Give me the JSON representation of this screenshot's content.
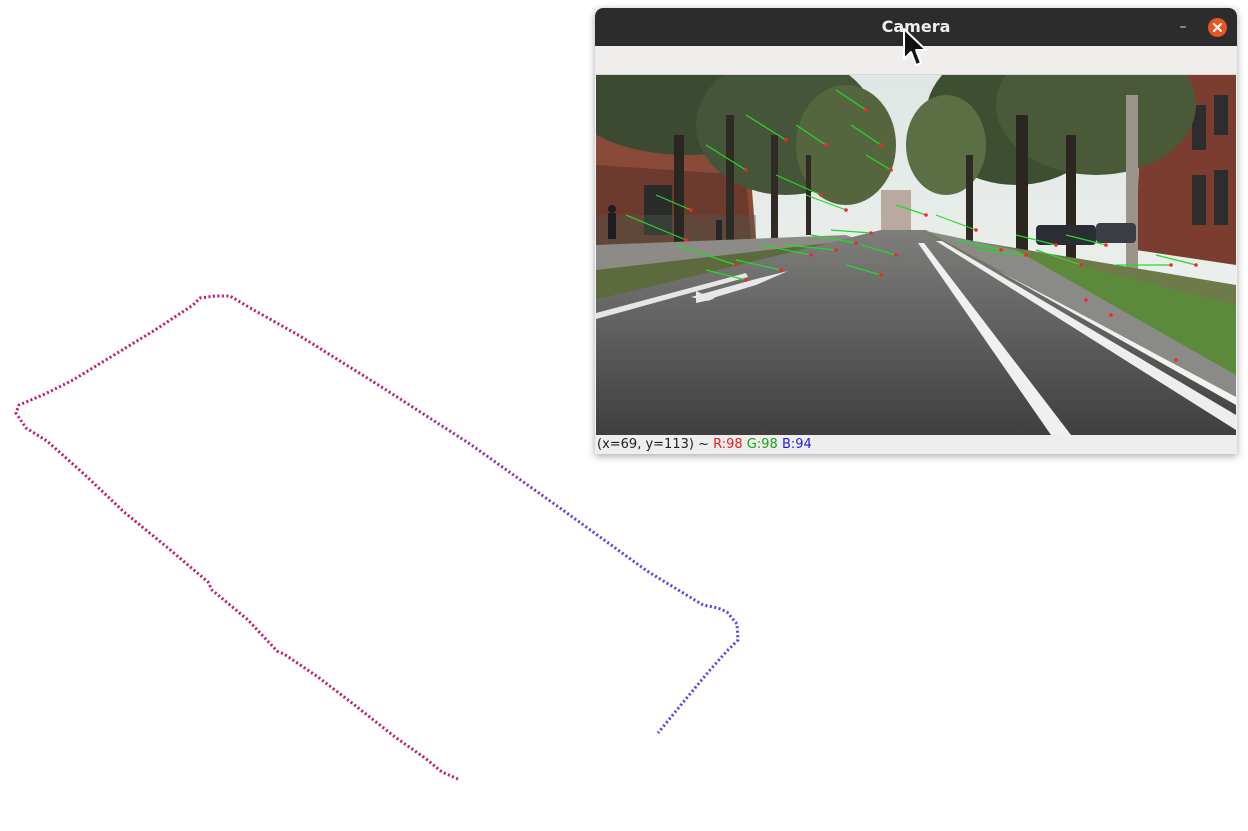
{
  "window": {
    "title": "Camera",
    "minimize_glyph": "–",
    "close_icon": "close-icon"
  },
  "statusbar": {
    "coords": "(x=69, y=113) ~ ",
    "r_text": "R:98",
    "g_text": "G:98",
    "b_text": "B:94",
    "r_color": "#e52020",
    "g_color": "#18a318",
    "b_color": "#2020e0"
  },
  "trajectory": {
    "start_color": "#c41570",
    "end_color": "#5a3ff0"
  },
  "features": {
    "flow_color": "#22dd22",
    "point_color": "#ff2222"
  }
}
